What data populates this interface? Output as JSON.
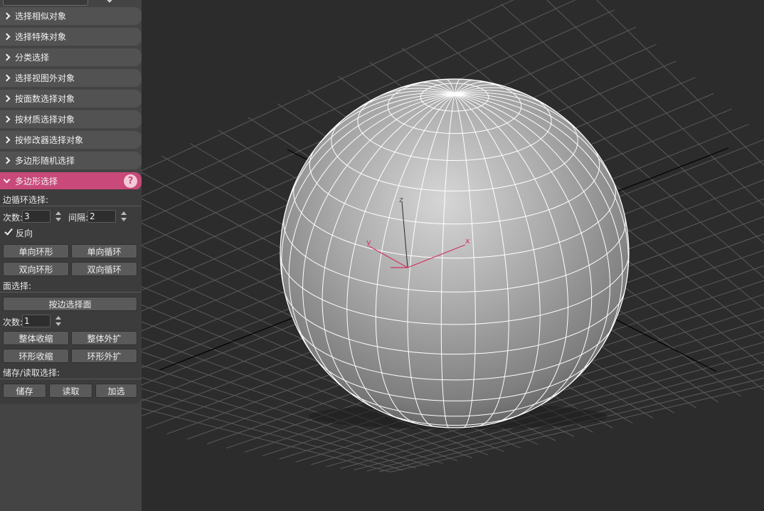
{
  "panel": {
    "rollouts": [
      {
        "label": "选择相似对象"
      },
      {
        "label": "选择特殊对象"
      },
      {
        "label": "分类选择"
      },
      {
        "label": "选择视图外对象"
      },
      {
        "label": "按面数选择对象"
      },
      {
        "label": "按材质选择对象"
      },
      {
        "label": "按修改器选择对象"
      },
      {
        "label": "多边形随机选择"
      }
    ],
    "active_rollout": {
      "label": "多边形选择",
      "help": "?"
    },
    "edge_loop": {
      "title": "边循环选择:",
      "count_label": "次数:",
      "count_value": "3",
      "interval_label": "间隔:",
      "interval_value": "2",
      "reverse_label": "反向",
      "reverse_checked": true,
      "buttons": [
        "单向环形",
        "单向循环",
        "双向环形",
        "双向循环"
      ]
    },
    "face_select": {
      "title": "面选择:",
      "by_edge_button": "按边选择面",
      "count_label": "次数:",
      "count_value": "1",
      "buttons": [
        "整体收缩",
        "整体外扩",
        "环形收缩",
        "环形外扩"
      ]
    },
    "store": {
      "title": "储存/读取选择:",
      "buttons": [
        "储存",
        "读取",
        "加选"
      ]
    }
  },
  "viewport": {
    "gizmo": {
      "x_label": "x",
      "y_label": "y",
      "z_label": "z"
    },
    "colors": {
      "background": "#2c2c2c",
      "grid": "#5a5a5a",
      "axis": "#000000",
      "gizmo": "#d2335e",
      "wire": "#ffffff"
    }
  }
}
